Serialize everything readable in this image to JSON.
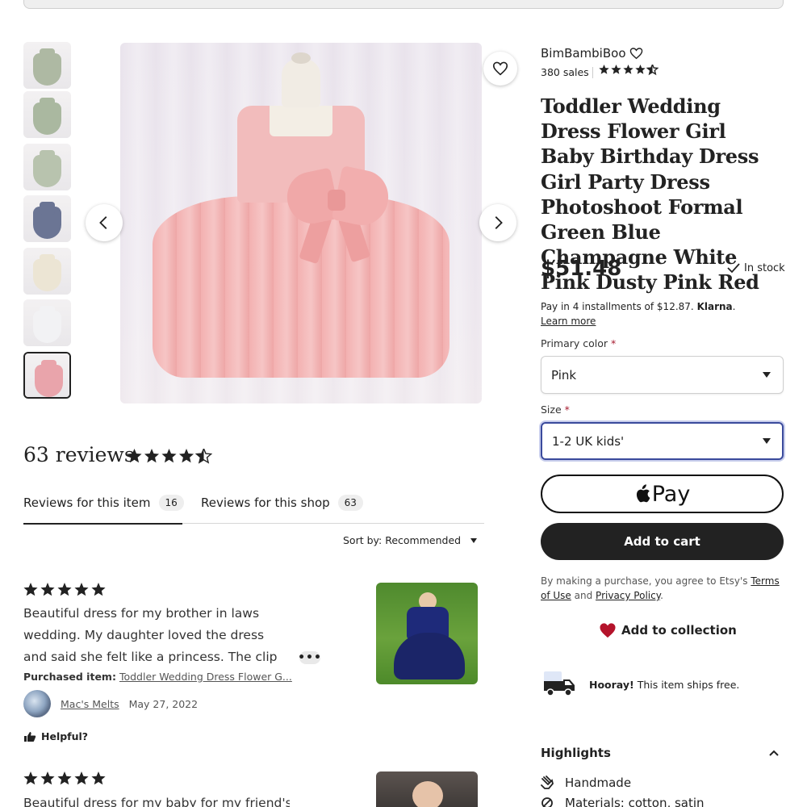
{
  "gallery": {
    "thumbnails": [
      {
        "color": "#aeb9a3"
      },
      {
        "color": "#aab8a0"
      },
      {
        "color": "#b8c3ae"
      },
      {
        "color": "#6b7594"
      },
      {
        "color": "#ece5d4"
      },
      {
        "color": "#f2f2f4"
      },
      {
        "color": "#e9a4ab"
      }
    ],
    "selected_index": 6,
    "main_dress_color": "#f2bcbc"
  },
  "shop": {
    "name": "BimBambiBoo",
    "sales": "380 sales",
    "rating": 4.5
  },
  "listing": {
    "title": "Toddler Wedding Dress Flower Girl Baby Birthday Dress Girl Party Dress Photoshoot Formal Green Blue Champagne White Pink Dusty Pink Red",
    "price": "$51.48",
    "stock": "In stock",
    "klarna_text": "Pay in 4 installments of $12.87.",
    "klarna_brand": "Klarna",
    "klarna_period": ".",
    "learn_more": "Learn more"
  },
  "options": {
    "color_label": "Primary color",
    "color_value": "Pink",
    "size_label": "Size",
    "size_value": "1-2 UK kids'",
    "required_mark": "*"
  },
  "buttons": {
    "apple_pay": "Pay",
    "add_to_cart": "Add to cart",
    "add_to_collection": "Add to collection"
  },
  "terms": {
    "prefix": "By making a purchase, you agree to Etsy's",
    "terms_link": "Terms of Use",
    "and": "and",
    "privacy_link": "Privacy Policy",
    "suffix": "."
  },
  "shipping": {
    "bold": "Hooray!",
    "text": "This item ships free."
  },
  "highlights": {
    "title": "Highlights",
    "items": [
      "Handmade",
      "Materials: cotton, satin"
    ]
  },
  "reviews": {
    "count_label": "63 reviews",
    "rating": 4.5,
    "tabs": [
      {
        "label": "Reviews for this item",
        "count": "16"
      },
      {
        "label": "Reviews for this shop",
        "count": "63"
      }
    ],
    "sort_label": "Sort by: Recommended",
    "items": [
      {
        "stars": 5,
        "text": "Beautiful dress for my brother in laws wedding. My daughter loved the dress and said she felt like a princess. The clip on bo...",
        "purchased_label": "Purchased item:",
        "purchased_item": "Toddler Wedding Dress Flower G...",
        "reviewer": "Mac's Melts",
        "date": "May 27, 2022",
        "helpful": "Helpful?"
      },
      {
        "stars": 5,
        "text": "Beautiful dress for my baby for my friend's"
      }
    ]
  },
  "colors": {
    "accent": "#222222",
    "required": "#a61a2e",
    "heart": "#b4132b",
    "focus": "#3a4a9c"
  }
}
